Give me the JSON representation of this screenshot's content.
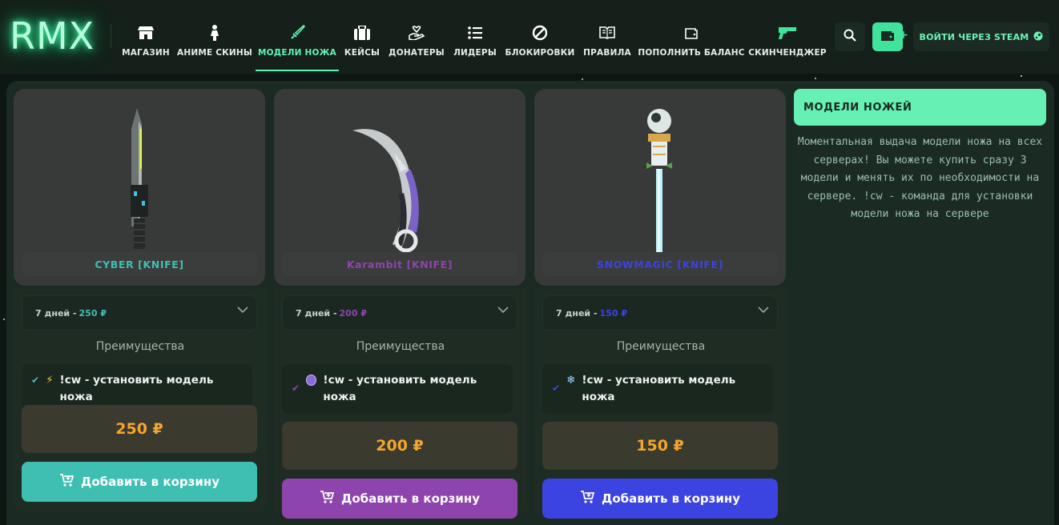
{
  "logo": {
    "text": "RMX"
  },
  "nav": [
    {
      "label": "МАГАЗИН",
      "icon": "store-icon"
    },
    {
      "label": "АНИМЕ СКИНЫ",
      "icon": "person-icon"
    },
    {
      "label": "МОДЕЛИ НОЖА",
      "icon": "sword-icon",
      "active": true
    },
    {
      "label": "КЕЙСЫ",
      "icon": "briefcase-icon"
    },
    {
      "label": "ДОНАТЕРЫ",
      "icon": "donate-icon"
    },
    {
      "label": "ЛИДЕРЫ",
      "icon": "list-icon"
    },
    {
      "label": "БЛОКИРОВКИ",
      "icon": "ban-icon"
    },
    {
      "label": "ПРАВИЛА",
      "icon": "book-icon"
    },
    {
      "label": "ПОПОЛНИТЬ БАЛАНС",
      "icon": "wallet-icon"
    },
    {
      "label": "СКИНЧЕНДЖЕР",
      "icon": "gun-icon"
    }
  ],
  "header_actions": {
    "search_icon": "search-icon",
    "wallet_icon": "wallet-add-icon",
    "plus": "+",
    "steam_label": "ВОЙТИ ЧЕРЕЗ STEAM",
    "steam_icon": "steam-icon"
  },
  "products": [
    {
      "name": "CYBER [KNIFE]",
      "accent": "#3fbfb2",
      "duration": "7 дней - ",
      "duration_price": "250 ₽",
      "advantages_title": "Преимущества",
      "feature_icon": "⚡",
      "feature_text": "!cw - установить модель ножа",
      "price": "250 ₽",
      "buy_label": "Добавить в корзину"
    },
    {
      "name": "Karambit [KNIFE]",
      "accent": "#8e44ad",
      "duration": "7 дней - ",
      "duration_price": "200 ₽",
      "advantages_title": "Преимущества",
      "feature_icon": "🟣",
      "feature_text": "!cw - установить модель ножа",
      "price": "200 ₽",
      "buy_label": "Добавить в корзину"
    },
    {
      "name": "SNOWMAGIC [KNIFE]",
      "accent": "#3b43e0",
      "duration": "7 дней - ",
      "duration_price": "150 ₽",
      "advantages_title": "Преимущества",
      "feature_icon": "❄",
      "feature_text": "!cw - установить модель ножа",
      "price": "150 ₽",
      "buy_label": "Добавить в корзину"
    }
  ],
  "sidebar": {
    "title": "МОДЕЛИ НОЖЕЙ",
    "description": "Моментальная выдача модели ножа на всех серверах! Вы можете купить сразу 3 модели и менять их по необходимости на сервере. !cw - команда для установки модели ножа на сервере"
  },
  "colors": {
    "accent": "#64f2b3",
    "price": "#f5a52c",
    "background": "#0d1612"
  }
}
